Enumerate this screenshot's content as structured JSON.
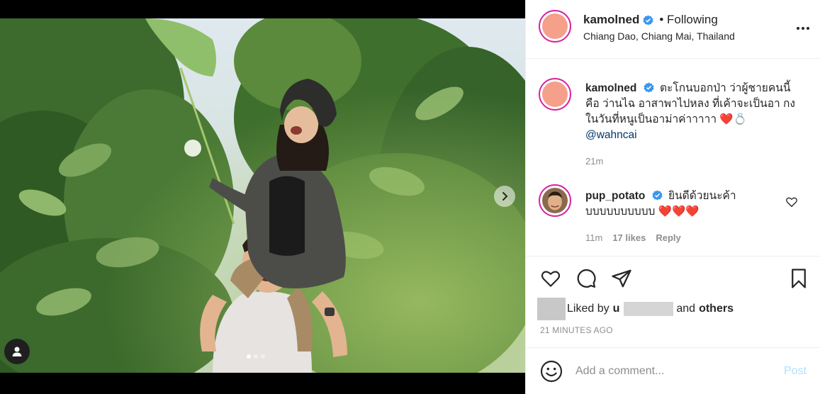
{
  "post": {
    "author": "kamolned",
    "follow_status": "• Following",
    "location": "Chiang Dao, Chiang Mai, Thailand"
  },
  "caption": {
    "username": "kamolned",
    "text": "ตะโกนบอกป่า ว่าผู้ชายคนนี้ คือ ว่านไฉ อาสาพาไปหลง ที่เค้าจะเป็นอา กงในวันที่หนูเป็นอาม่าค่าาาาา",
    "emojis": "❤️💍",
    "mention": "@wahncai",
    "time": "21m"
  },
  "reply": {
    "username": "pup_potato",
    "text": "ยินดีด้วยนะค้า บบบบบบบบบบ",
    "emojis": "❤️❤️❤️",
    "time": "11m",
    "likes": "17 likes",
    "reply_label": "Reply"
  },
  "likes": {
    "prefix": "Liked by",
    "user_partial": "u",
    "conjunction": "and",
    "others": "others"
  },
  "timestamp": "21 MINUTES AGO",
  "comment_box": {
    "placeholder": "Add a comment...",
    "post_label": "Post"
  },
  "carousel": {
    "slide_count": 3,
    "active_slide": 1
  },
  "colors": {
    "verified": "#3897f0",
    "story_ring": "#d6249f",
    "avatar_fill": "#f4a08a",
    "mention": "#00376b",
    "post_button": "#b2dffc"
  },
  "icons": [
    "user-tag-icon",
    "chevron-right-icon",
    "more-options-icon",
    "verified-badge-icon",
    "heart-icon",
    "comment-icon",
    "share-icon",
    "bookmark-icon",
    "emoji-icon"
  ]
}
